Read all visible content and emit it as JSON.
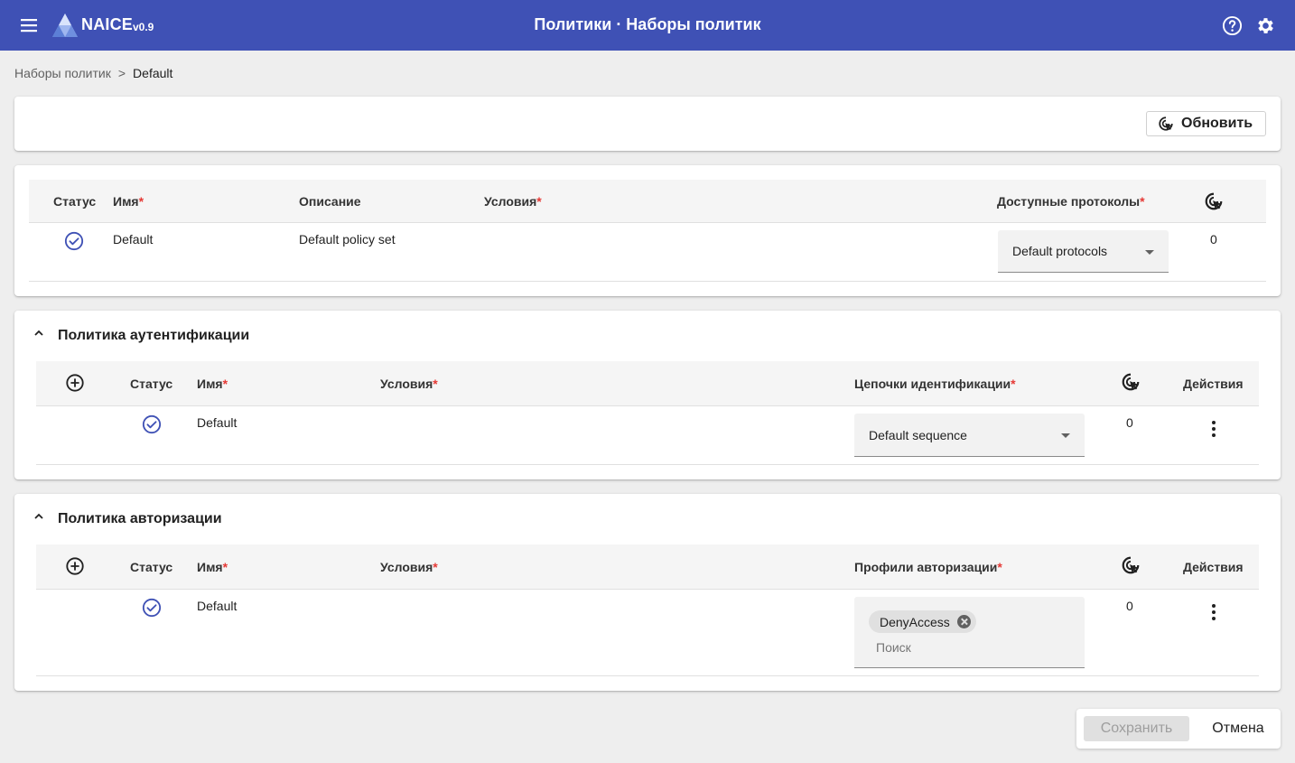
{
  "header": {
    "app_name": "NAICE",
    "version": "v0.9",
    "title": "Политики · Наборы политик",
    "icons": [
      "menu-icon",
      "naice-logo",
      "help-icon",
      "gear-icon"
    ],
    "color": "#3f51b5"
  },
  "breadcrumb": {
    "parent": "Наборы политик",
    "separator": ">",
    "current": "Default"
  },
  "toolbar": {
    "refresh_label": "Обновить"
  },
  "policy_set": {
    "columns": {
      "status": "Статус",
      "name": "Имя",
      "description": "Описание",
      "conditions": "Условия",
      "protocols": "Доступные протоколы",
      "required_mark": "*"
    },
    "row": {
      "status": "enabled",
      "name": "Default",
      "description": "Default policy set",
      "conditions": "",
      "protocols": "Default protocols",
      "hits": "0"
    }
  },
  "auth_policy": {
    "title": "Политика аутентификации",
    "columns": {
      "status": "Статус",
      "name": "Имя",
      "conditions": "Условия",
      "sequences": "Цепочки идентификации",
      "actions": "Действия",
      "required_mark": "*"
    },
    "row": {
      "status": "enabled",
      "name": "Default",
      "sequence": "Default sequence",
      "hits": "0"
    }
  },
  "authz_policy": {
    "title": "Политика авторизации",
    "columns": {
      "status": "Статус",
      "name": "Имя",
      "conditions": "Условия",
      "profiles": "Профили авторизации",
      "actions": "Действия",
      "required_mark": "*"
    },
    "row": {
      "status": "enabled",
      "name": "Default",
      "profile_chip": "DenyAccess",
      "search_placeholder": "Поиск",
      "hits": "0"
    }
  },
  "footer": {
    "save_label": "Сохранить",
    "cancel_label": "Отмена"
  },
  "colors": {
    "primary": "#3f51b5",
    "required": "#e53935",
    "status_ok": "#3f51b5"
  }
}
